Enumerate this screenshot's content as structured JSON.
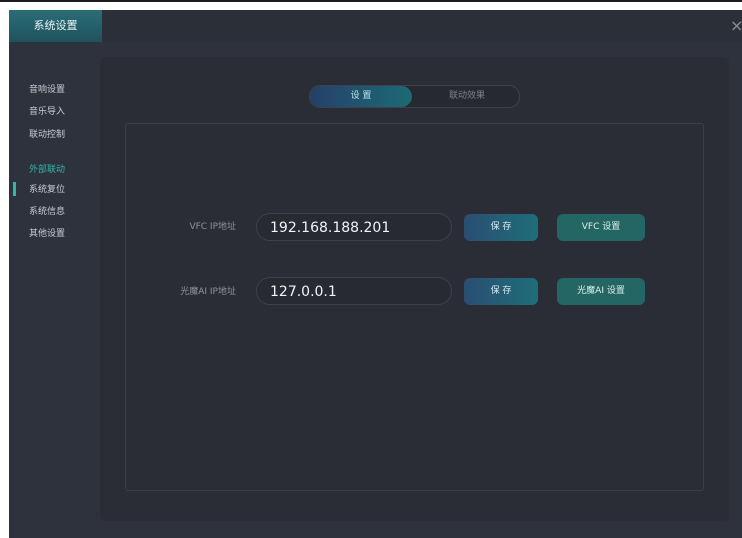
{
  "window": {
    "title": "系统设置",
    "close_glyph": "×"
  },
  "sidebar": {
    "items": [
      {
        "label": "音响设置",
        "active": false
      },
      {
        "label": "音乐导入",
        "active": false
      },
      {
        "label": "联动控制",
        "active": false
      },
      {
        "label": "外部联动",
        "active": true
      },
      {
        "label": "系统复位",
        "active": false
      },
      {
        "label": "系统信息",
        "active": false
      },
      {
        "label": "其他设置",
        "active": false
      }
    ]
  },
  "tabs": {
    "settings": "设 置",
    "effect": "联动效果",
    "active": "settings"
  },
  "rows": [
    {
      "label": "VFC IP地址",
      "value": "192.168.188.201",
      "save": "保 存",
      "setting": "VFC 设置"
    },
    {
      "label": "光魔AI IP地址",
      "value": "127.0.0.1",
      "save": "保 存",
      "setting": "光魔AI 设置"
    }
  ],
  "colors": {
    "accent": "#2fb7a8",
    "background": "#2e323c",
    "panel": "#2a2d36"
  },
  "icons": {
    "close": "close-icon"
  }
}
